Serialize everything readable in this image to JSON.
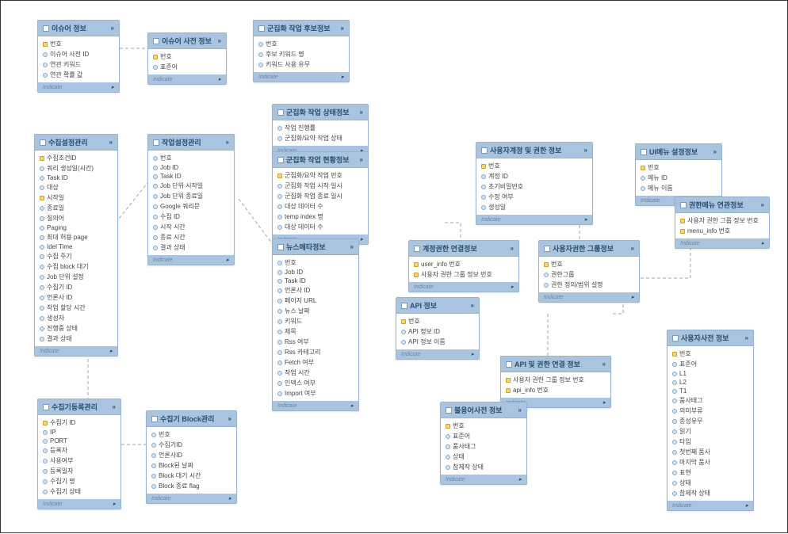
{
  "footer_text": "Indicate",
  "entities": {
    "e1": {
      "title": "이슈어 정보",
      "attrs": [
        "번호",
        "이슈어 사전 ID",
        "연관 키워드",
        "연관 확률 값"
      ],
      "keys": [
        0
      ]
    },
    "e2": {
      "title": "이슈어 사전 정보",
      "attrs": [
        "번호",
        "표준어"
      ],
      "keys": [
        0
      ]
    },
    "e3": {
      "title": "군집화 작업 후보정보",
      "attrs": [
        "번호",
        "후보 키워드 명",
        "키워드 사용 유무"
      ],
      "keys": []
    },
    "e4": {
      "title": "수집설정관리",
      "attrs": [
        "수집조건ID",
        "쿼리 생성일(시간)",
        "Task ID",
        "대상",
        "시작일",
        "종료일",
        "질의어",
        "Paging",
        "최대 허용 page",
        "Idel Time",
        "수집 주기",
        "수집 block 대기",
        "Job 단위 설정",
        "수집기 ID",
        "언론사 ID",
        "작업 할당 시간",
        "생성자",
        "진행중 상태",
        "결과 상태"
      ],
      "keys": [
        0,
        4
      ]
    },
    "e5": {
      "title": "작업설정관리",
      "attrs": [
        "번호",
        "Job ID",
        "Task ID",
        "Job 단위 시작일",
        "Job 단위 종료일",
        "Google 쿼리문",
        "수집 ID",
        "시작 시간",
        "종료 시간",
        "결과 상태"
      ],
      "keys": []
    },
    "e6": {
      "title": "군집화 작업 상태정보",
      "attrs": [
        "작업 진행률",
        "군집화/요약 작업 상태"
      ],
      "keys": []
    },
    "e7": {
      "title": "군집화 작업 현황정보",
      "attrs": [
        "군집화/요약 작업 번호",
        "군집화 작업 시작 일시",
        "군집화 작업 종료 일시",
        "대상 데이터 수",
        "temp index 명",
        "대상 데이터 수"
      ],
      "keys": [
        0
      ]
    },
    "e8": {
      "title": "뉴스메타정보",
      "attrs": [
        "번호",
        "Job ID",
        "Task ID",
        "언론사 ID",
        "페이지 URL",
        "뉴스 날짜",
        "키워드",
        "제목",
        "Rss 여부",
        "Rss 카테고리",
        "Fetch 여부",
        "작업 시간",
        "인덱스 여부",
        "Import 여부"
      ],
      "keys": []
    },
    "e9": {
      "title": "수집기등록관리",
      "attrs": [
        "수집기 ID",
        "IP",
        "PORT",
        "등록자",
        "사용여부",
        "등록일자",
        "수집기 명",
        "수집기 상태"
      ],
      "keys": [
        0
      ]
    },
    "e10": {
      "title": "수집기 Block관리",
      "attrs": [
        "번호",
        "수집기ID",
        "언론사ID",
        "Block된 날짜",
        "Block 대기 시간",
        "Block 종료 flag"
      ],
      "keys": []
    },
    "e11": {
      "title": "사용자계정 및 권한 정보",
      "attrs": [
        "번호",
        "계정 ID",
        "초기비밀번호",
        "수정 여부",
        "생성일"
      ],
      "keys": [
        0
      ]
    },
    "e12": {
      "title": "UI메뉴 설정정보",
      "attrs": [
        "번호",
        "메뉴 ID",
        "메뉴 이름"
      ],
      "keys": [
        0
      ]
    },
    "e13": {
      "title": "권한메뉴 연관정보",
      "attrs": [
        "사용자 권한 그룹 정보 번호",
        "menu_info 번호"
      ],
      "keys": [
        0,
        1
      ]
    },
    "e14": {
      "title": "계정권한 연결정보",
      "attrs": [
        "user_info 번호",
        "사용자 권한 그룹 정보 번호"
      ],
      "keys": [
        0,
        1
      ]
    },
    "e15": {
      "title": "사용자권한 그룹정보",
      "attrs": [
        "번호",
        "권한그룹",
        "권한 정의/범위 설명"
      ],
      "keys": [
        0
      ]
    },
    "e16": {
      "title": "API 정보",
      "attrs": [
        "번호",
        "API 정보 ID",
        "API 정보 이름"
      ],
      "keys": [
        0
      ]
    },
    "e17": {
      "title": "API 및 권한 연결 정보",
      "attrs": [
        "사용자 권한 그룹 정보 번호",
        "api_info 번호"
      ],
      "keys": [
        0,
        1
      ]
    },
    "e18": {
      "title": "불용어사전 정보",
      "attrs": [
        "번호",
        "표준어",
        "품사태그",
        "상태",
        "참제작 상태"
      ],
      "keys": [
        0
      ]
    },
    "e19": {
      "title": "사용자사전 정보",
      "attrs": [
        "번호",
        "표준어",
        "L1",
        "L2",
        "T1",
        "품사태그",
        "의미부류",
        "종성유무",
        "읽기",
        "타입",
        "첫번째 품사",
        "마지막 품사",
        "표현",
        "상태",
        "참제작 상태"
      ],
      "keys": [
        0
      ]
    }
  }
}
